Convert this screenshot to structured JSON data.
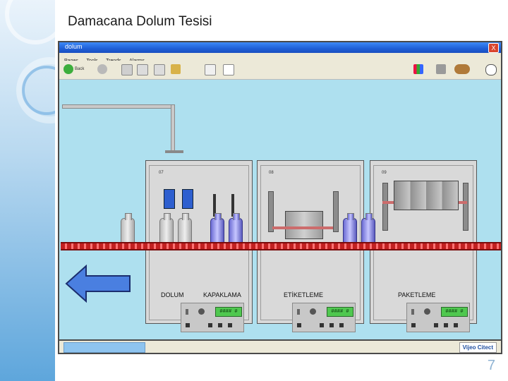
{
  "slide": {
    "title": "Damacana Dolum Tesisi",
    "page_number": "7"
  },
  "window": {
    "title": "dolum",
    "close_label": "X",
    "menu": [
      "Pages",
      "Tools",
      "Trends",
      "Alarms"
    ],
    "toolbar": {
      "back_label": "Back",
      "icons": [
        "back-icon",
        "forward-icon",
        "up-folder-icon",
        "page-icon",
        "page-icon",
        "home-icon",
        "menu-icon",
        "notes-icon",
        "chart-icon",
        "print-icon",
        "users-icon",
        "help-icon"
      ]
    },
    "status_brand": "Vijeo Citect"
  },
  "stations": [
    {
      "label": "DOLUM",
      "secondary_label": "KAPAKLAMA",
      "number": "07",
      "display": "#### #"
    },
    {
      "label": "ETİKETLEME",
      "number": "08",
      "display": "#### #"
    },
    {
      "label": "PAKETLEME",
      "number": "09",
      "display": "#### #"
    }
  ],
  "colors": {
    "belt": "#d91e1e",
    "jug_full": "#8a8ae0",
    "lcd": "#4fc84f",
    "arrow": "#4a7fe0"
  }
}
